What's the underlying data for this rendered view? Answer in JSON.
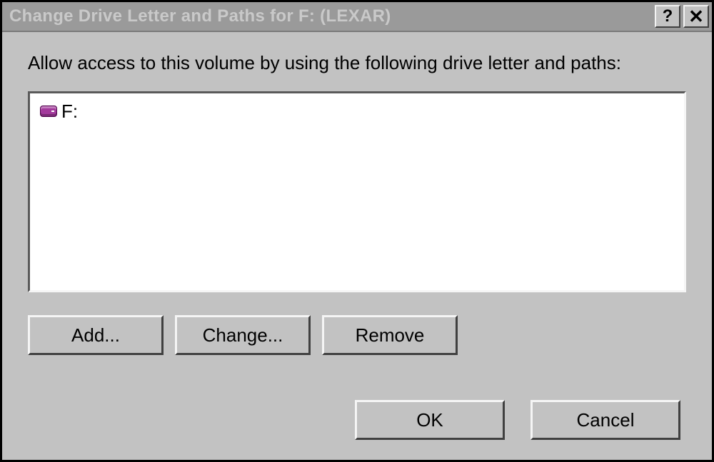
{
  "title": "Change Drive Letter and Paths for F: (LEXAR)",
  "instruction": "Allow access to this volume by using the following drive letter and paths:",
  "list": {
    "items": [
      {
        "label": "F:"
      }
    ]
  },
  "buttons": {
    "add": "Add...",
    "change": "Change...",
    "remove": "Remove",
    "ok": "OK",
    "cancel": "Cancel"
  },
  "titlebar_icons": {
    "help": "?",
    "close": "✕"
  }
}
